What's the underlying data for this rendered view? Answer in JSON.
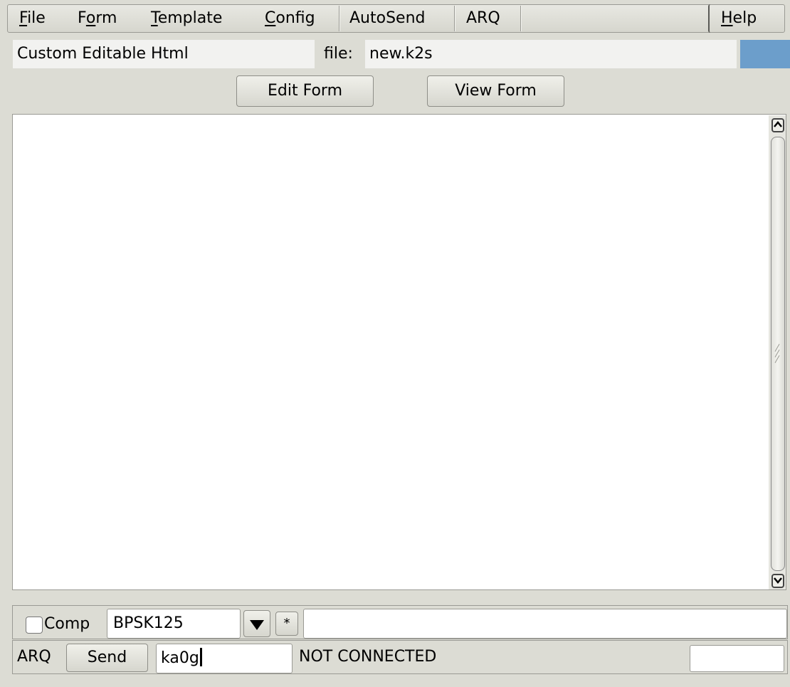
{
  "menubar": {
    "items": [
      {
        "prefix": "",
        "mnemonic": "F",
        "rest": "ile"
      },
      {
        "prefix": "F",
        "mnemonic": "o",
        "rest": "rm"
      },
      {
        "prefix": "",
        "mnemonic": "T",
        "rest": "emplate"
      },
      {
        "prefix": "",
        "mnemonic": "C",
        "rest": "onfig"
      },
      {
        "prefix": "AutoSend",
        "mnemonic": "",
        "rest": ""
      },
      {
        "prefix": "ARQ",
        "mnemonic": "",
        "rest": ""
      }
    ],
    "help": {
      "mnemonic": "H",
      "rest": "elp"
    }
  },
  "info": {
    "form_type": "Custom Editable Html",
    "file_label": "file:",
    "file_name": "new.k2s",
    "indicator_color": "#6c9ecb"
  },
  "buttons": {
    "edit_form": "Edit Form",
    "view_form": "View Form"
  },
  "editor": {
    "content": ""
  },
  "mode_row": {
    "comp_label": "Comp",
    "comp_checked": false,
    "mode_value": "BPSK125",
    "star_label": "*",
    "extra_value": ""
  },
  "arq_row": {
    "arq_label": "ARQ",
    "send_label": "Send",
    "callsign_value": "ka0g",
    "status_text": "NOT CONNECTED",
    "right_value": ""
  },
  "icons": {
    "dropdown": "triangle-down",
    "scroll_up": "chevron-up",
    "scroll_down": "chevron-down"
  }
}
